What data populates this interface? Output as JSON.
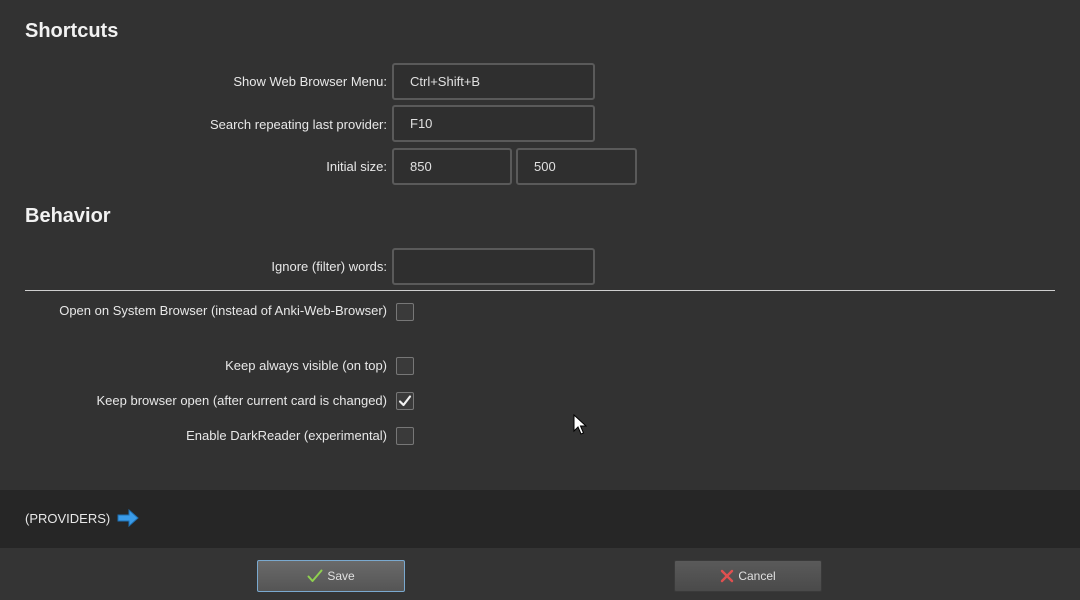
{
  "shortcuts": {
    "title": "Shortcuts",
    "show_menu_label": "Show Web Browser Menu:",
    "show_menu_value": "Ctrl+Shift+B",
    "search_repeat_label": "Search repeating last provider:",
    "search_repeat_value": "F10",
    "initial_size_label": "Initial size:",
    "initial_width_value": "850",
    "initial_height_value": "500"
  },
  "behavior": {
    "title": "Behavior",
    "ignore_words_label": "Ignore (filter) words:",
    "ignore_words_value": "",
    "options": [
      {
        "label": "Open on System Browser (instead of Anki-Web-Browser)",
        "checked": false
      },
      {
        "label": "Keep always visible (on top)",
        "checked": false
      },
      {
        "label": "Keep browser open (after current card is changed)",
        "checked": true
      },
      {
        "label": "Enable DarkReader (experimental)",
        "checked": false
      }
    ]
  },
  "providers": {
    "label": "(PROVIDERS)",
    "arrow_icon": "arrow-right-icon",
    "arrow_color": "#3a9be8"
  },
  "footer": {
    "save_label": "Save",
    "cancel_label": "Cancel",
    "save_icon_color": "#8fd14f",
    "cancel_icon_color": "#e05050"
  }
}
